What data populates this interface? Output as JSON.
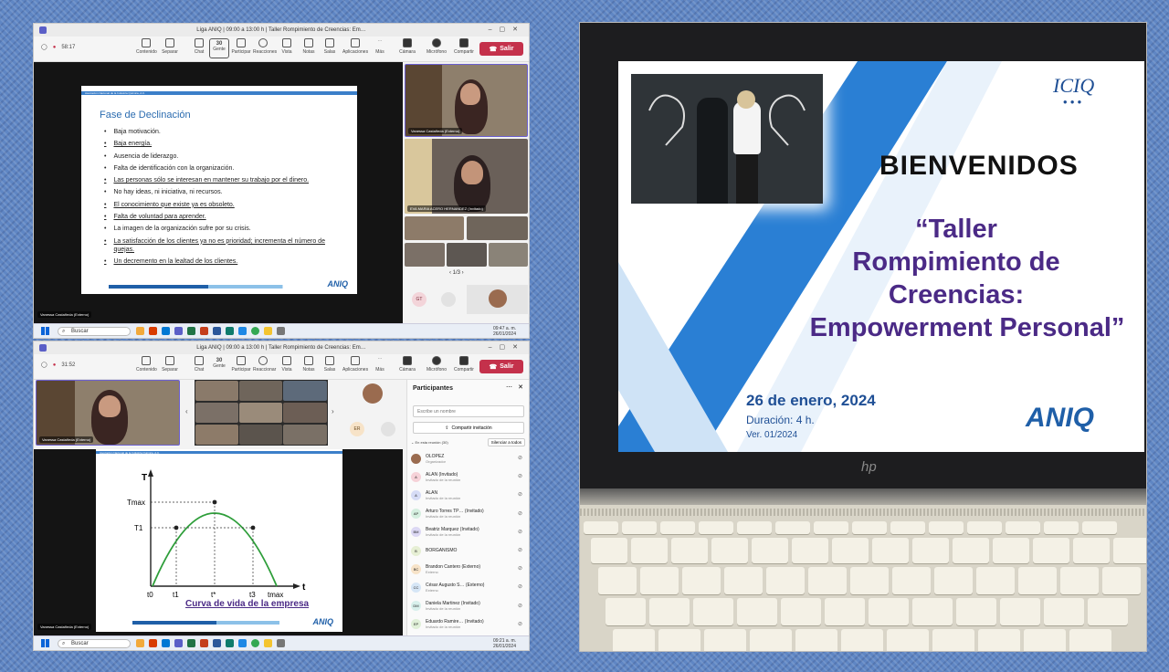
{
  "top_window": {
    "title": "Liga ANIQ | 09:00 a 13:00 h | Taller Rompimiento de Creencias: Em…",
    "timer": "58:17",
    "toolbar": {
      "items": [
        "Contenido",
        "Separar",
        "Chat",
        "Gente",
        "Participar",
        "Reacciones",
        "Vista",
        "Notas",
        "Salas",
        "Aplicaciones",
        "Más",
        "Cámara",
        "Micrófono",
        "Compartir"
      ],
      "people_count": "30",
      "exit": "Salir"
    },
    "slide": {
      "header": "Asociación Nacional de la Industria Química, A.C.",
      "title": "Fase de Declinación",
      "bullets": [
        "Baja motivación.",
        "Baja energía.",
        "Ausencia de liderazgo.",
        "Falta de identificación con la organización.",
        "Las personas sólo se interesan en mantener su trabajo por el dinero.",
        "No hay ideas, ni iniciativa, ni recursos.",
        "El conocimiento que existe ya es obsoleto.",
        "Falta de voluntad para aprender.",
        "La imagen de la organización sufre por su crisis.",
        "La satisfacción de los clientes ya no es prioridad; incrementa el número de quejas.",
        "Un decremento en la lealtad de los clientes."
      ],
      "logo": "ANIQ"
    },
    "presenter_label": "Vanessa Castañeda (Externo)",
    "tile_1_name": "Vanessa Castañeda (Externo)",
    "tile_2_name": "EVA MARIA ACERO HERNANDEZ (Invitado)",
    "pager": "1/3",
    "initials": "GT",
    "taskbar": {
      "search": "Buscar",
      "time": "09:47 a. m.",
      "date": "26/01/2024"
    }
  },
  "bottom_window": {
    "title": "Liga ANIQ | 09:00 a 13:00 h | Taller Rompimiento de Creencias: Em…",
    "timer": "31:52",
    "toolbar": {
      "items": [
        "Contenido",
        "Separar",
        "Chat",
        "Gente",
        "Participar",
        "Reaccionar",
        "Vista",
        "Notas",
        "Salas",
        "Aplicaciones",
        "Más",
        "Cámara",
        "Micrófono",
        "Compartir"
      ],
      "people_count": "30",
      "exit": "Salir"
    },
    "presenter_tile": "Vanessa Castañeda (Externo)",
    "initials": "ER",
    "slide": {
      "header": "Asociación Nacional de la Industria Química, A.C.",
      "caption": "Curva de vida de la empresa",
      "y_label": "T",
      "x_label": "t",
      "y_ticks": [
        "Tmax",
        "T1"
      ],
      "x_ticks": [
        "t0",
        "t1",
        "t*",
        "t3",
        "tmax"
      ],
      "logo": "ANIQ"
    },
    "presenter_label": "Vanessa Castañeda (Externo)",
    "participants": {
      "heading": "Participantes",
      "search_placeholder": "Escribe un nombre",
      "share_invite": "Compartir invitación",
      "in_meeting": "En esta reunión (30)",
      "mute_all": "Silenciar a todos",
      "people": [
        {
          "initials": "",
          "name": "OLOPEZ",
          "role": "Organizador",
          "color": "#9a6b4f"
        },
        {
          "initials": "A",
          "name": "ALAN (Invitado)",
          "role": "Invitado de la reunión",
          "color": "#f6d2d8"
        },
        {
          "initials": "A",
          "name": "ALAN",
          "role": "Invitado de la reunión",
          "color": "#d6dcf6"
        },
        {
          "initials": "AP",
          "name": "Arturo Torres TP… (Invitado)",
          "role": "Invitado de la reunión",
          "color": "#d5efe0"
        },
        {
          "initials": "BM",
          "name": "Beatriz Marquez (Invitado)",
          "role": "Invitado de la reunión",
          "color": "#dcd8f4"
        },
        {
          "initials": "B",
          "name": "BORGANISMO",
          "role": "",
          "color": "#e6efd4"
        },
        {
          "initials": "BC",
          "name": "Brandon Cantero (Externo)",
          "role": "Externo",
          "color": "#f7e3c8"
        },
        {
          "initials": "CC",
          "name": "César Augusto S… (Externo)",
          "role": "Externo",
          "color": "#d6e6f6"
        },
        {
          "initials": "DM",
          "name": "Daniela Martinez (Invitado)",
          "role": "Invitado de la reunión",
          "color": "#d8f0ec"
        },
        {
          "initials": "EP",
          "name": "Eduardo Ramire… (Invitado)",
          "role": "Invitado de la reunión",
          "color": "#e0f0d8"
        }
      ]
    },
    "taskbar": {
      "search": "Buscar",
      "time": "09:21 a. m.",
      "date": "26/01/2024"
    }
  },
  "laptop_slide": {
    "brand_top": "ICIQ",
    "welcome": "BIENVENIDOS",
    "title_lines": [
      "“Taller",
      "Rompimiento de",
      "Creencias:",
      "Empowerment Personal”"
    ],
    "date": "26 de enero, 2024",
    "duration": "Duración: 4 h.",
    "version": "Ver. 01/2024",
    "logo": "ANIQ",
    "laptop_brand": "hp"
  },
  "colors": {
    "teams_purple": "#5b5fc7",
    "exit_red": "#c4314b",
    "aniq_blue": "#1f5fa8",
    "slide_title_purple": "#4b2a86"
  }
}
